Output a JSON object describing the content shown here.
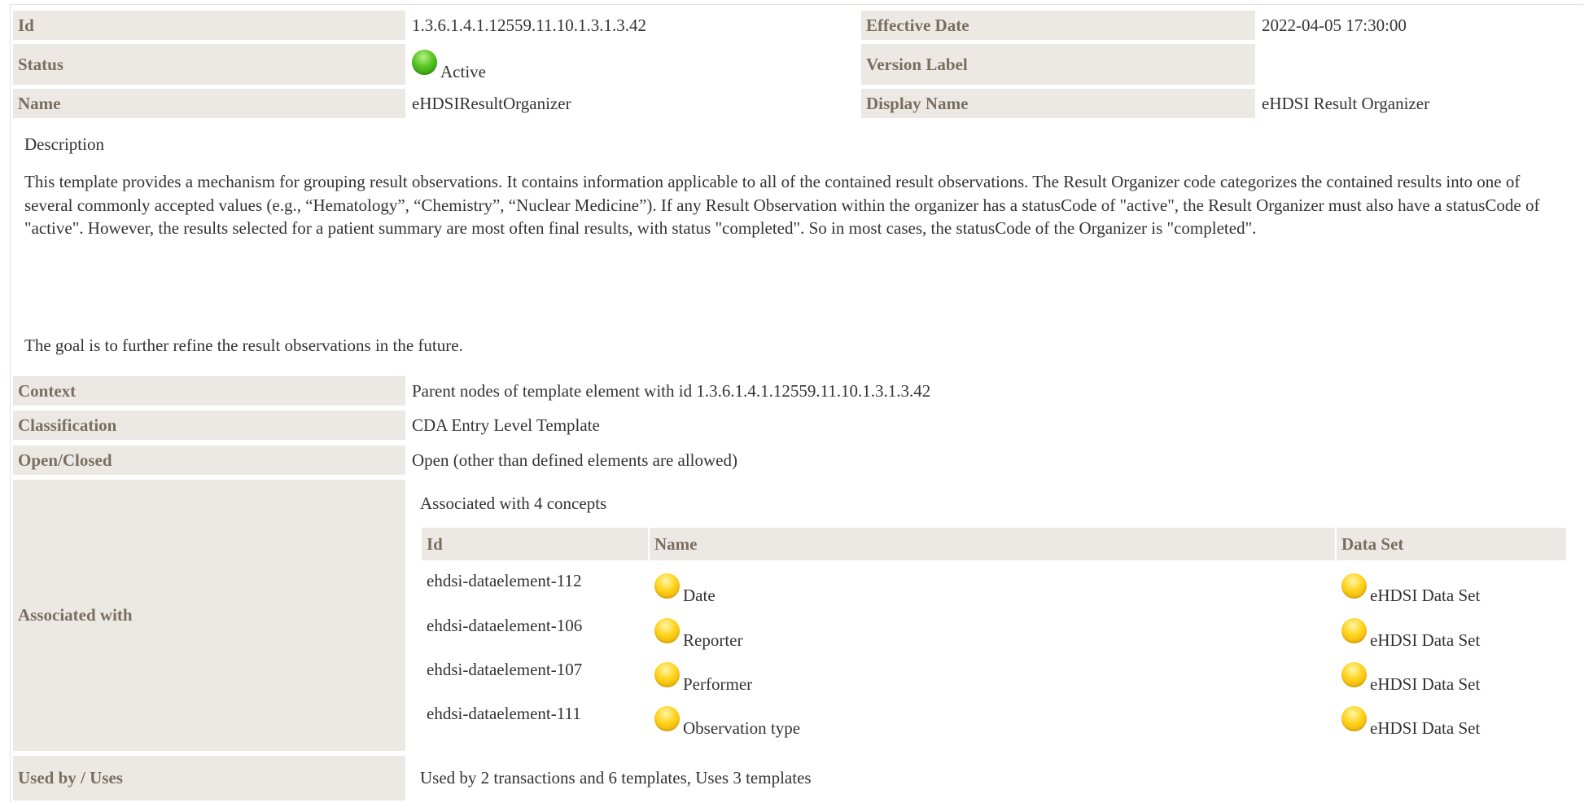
{
  "header": {
    "id_label": "Id",
    "id_value": "1.3.6.1.4.1.12559.11.10.1.3.1.3.42",
    "effective_date_label": "Effective Date",
    "effective_date_value": "2022-04-05 17:30:00",
    "status_label": "Status",
    "status_value": "Active",
    "status_color": "#54c41e",
    "version_label_label": "Version Label",
    "version_label_value": "",
    "name_label": "Name",
    "name_value": "eHDSIResultOrganizer",
    "display_name_label": "Display Name",
    "display_name_value": "eHDSI Result Organizer"
  },
  "description": {
    "heading": "Description",
    "body": "This template provides a mechanism for grouping result observations. It contains information applicable to all of the contained result observations. The Result Organizer code categorizes the contained results into one of several commonly accepted values (e.g., “Hematology”, “Chemistry”, “Nuclear Medicine”). If any Result Observation within the organizer has a statusCode of \"active\", the Result Organizer must also have a statusCode of \"active\". However, the results selected for a patient summary are most often final results, with status \"completed\". So in most cases, the statusCode of the Organizer is \"completed\".",
    "goal": "The goal is to further refine the result observations in the future."
  },
  "properties": {
    "context_label": "Context",
    "context_value": "Parent nodes of template element with id 1.3.6.1.4.1.12559.11.10.1.3.1.3.42",
    "classification_label": "Classification",
    "classification_value": "CDA Entry Level Template",
    "open_closed_label": "Open/Closed",
    "open_closed_value": "Open (other than defined elements are allowed)",
    "associated_label": "Associated with",
    "used_by_label": "Used by / Uses",
    "used_by_value": "Used by 2 transactions and 6 templates, Uses 3 templates"
  },
  "associations": {
    "summary": "Associated with 4 concepts",
    "columns": [
      "Id",
      "Name",
      "Data Set"
    ],
    "concept_status_color": "#ffd21a",
    "rows": [
      {
        "id": "ehdsi-dataelement-112",
        "name": "Date",
        "dataset": "eHDSI Data Set"
      },
      {
        "id": "ehdsi-dataelement-106",
        "name": "Reporter",
        "dataset": "eHDSI Data Set"
      },
      {
        "id": "ehdsi-dataelement-107",
        "name": "Performer",
        "dataset": "eHDSI Data Set"
      },
      {
        "id": "ehdsi-dataelement-111",
        "name": "Observation type",
        "dataset": "eHDSI Data Set"
      }
    ]
  }
}
